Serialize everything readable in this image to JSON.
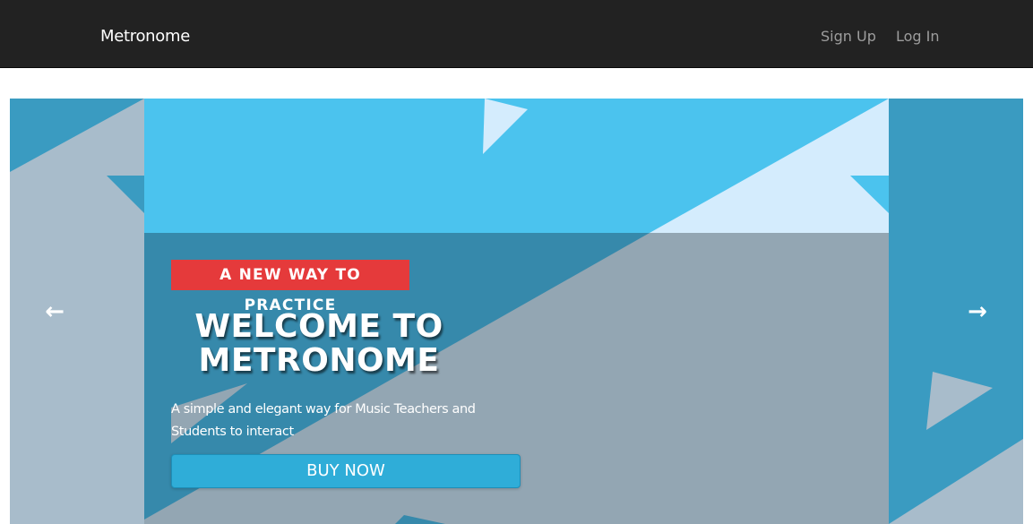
{
  "navbar": {
    "brand": "Metronome",
    "links": [
      {
        "label": "Sign Up"
      },
      {
        "label": "Log In"
      }
    ]
  },
  "carousel": {
    "prev_icon": "arrow-left-icon",
    "next_icon": "arrow-right-icon",
    "prev_glyph": "←",
    "next_glyph": "→",
    "slide": {
      "badge": "A NEW WAY TO PRACTICE",
      "headline": "WELCOME TO METRONOME",
      "subtext": "A simple and elegant way for Music Teachers and Students to interact",
      "cta": "BUY NOW"
    }
  },
  "colors": {
    "navbar_bg": "#222222",
    "badge_bg": "#e53a3b",
    "button_bg": "#2fadd8",
    "sky_blue": "#4bc3ee",
    "dark_blue": "#3a9bc1",
    "pale_blue": "#d4ecfd",
    "grey_blue": "#94a6b4"
  }
}
